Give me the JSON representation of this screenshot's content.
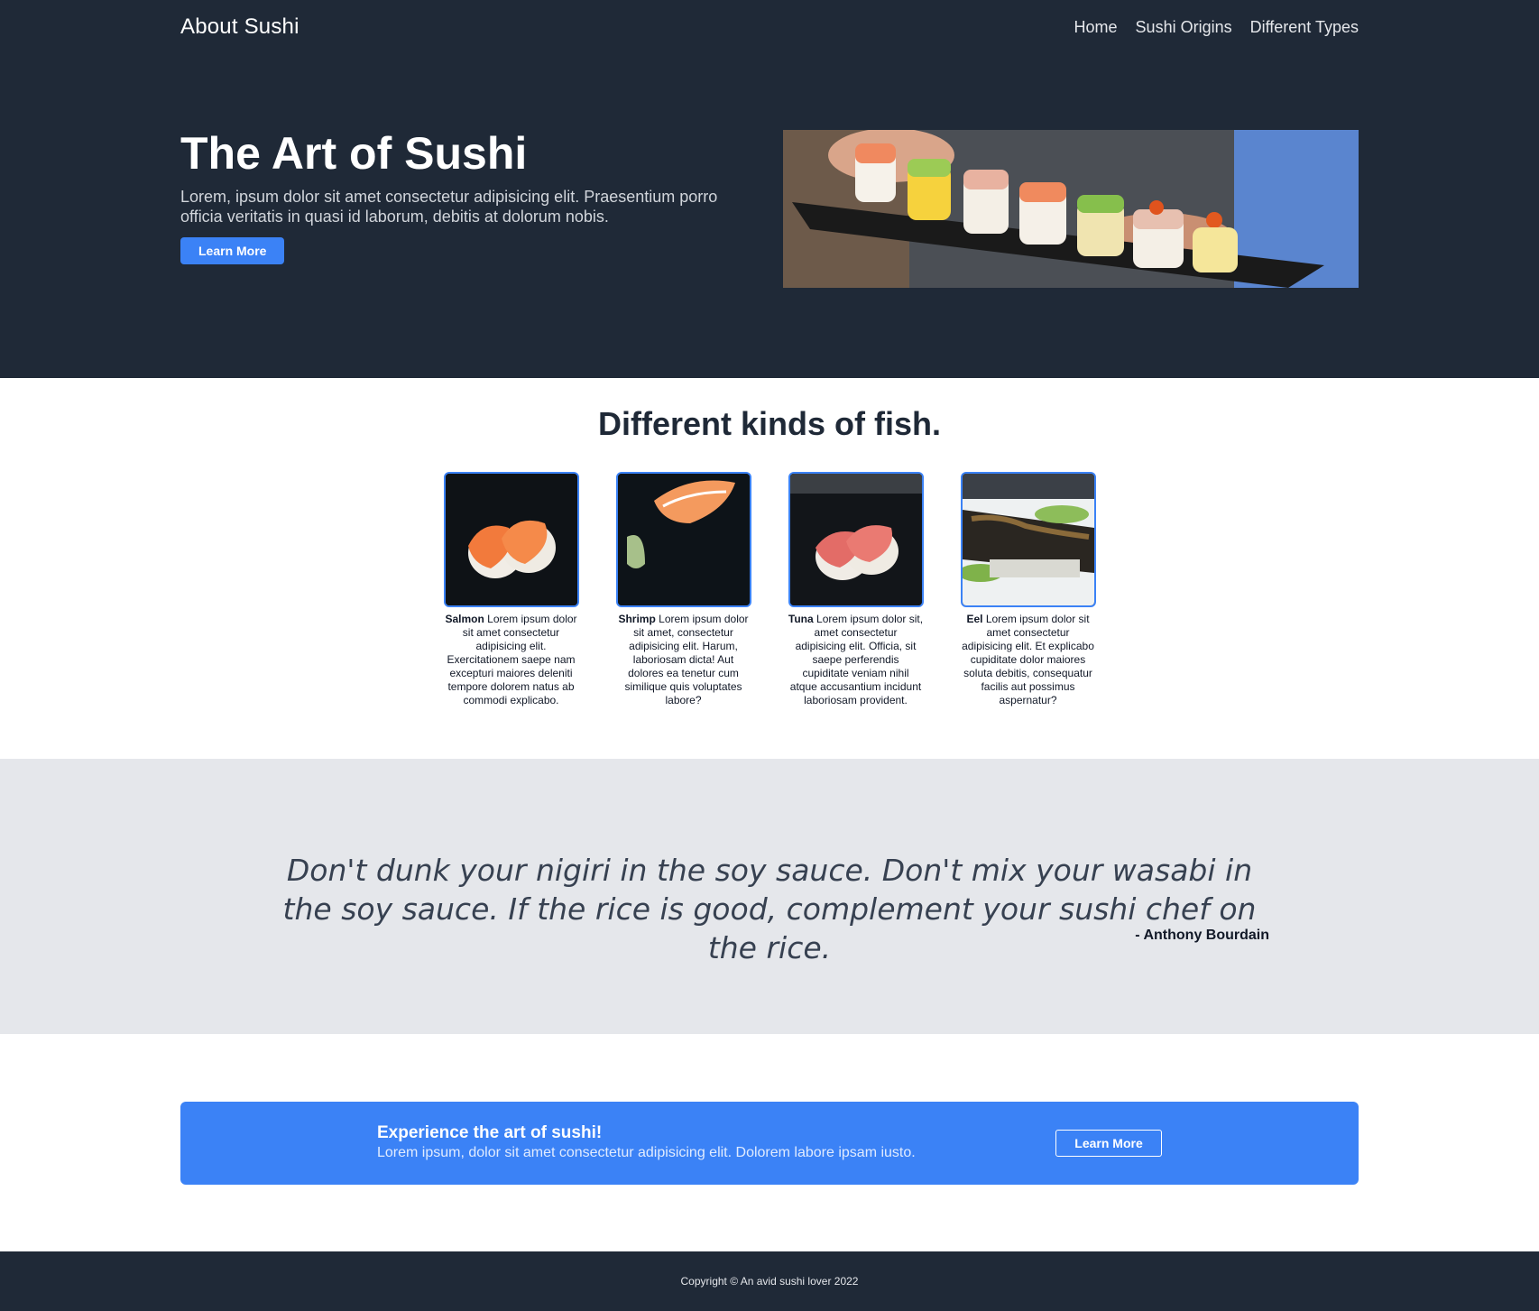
{
  "header": {
    "brand": "About Sushi",
    "nav": [
      "Home",
      "Sushi Origins",
      "Different Types"
    ]
  },
  "hero": {
    "title": "The Art of Sushi",
    "subtitle": "Lorem, ipsum dolor sit amet consectetur adipisicing elit. Praesentium porro officia veritatis in quasi id laborum, debitis at dolorum nobis.",
    "button": "Learn More"
  },
  "fish": {
    "title": "Different kinds of fish.",
    "items": [
      {
        "name": "Salmon",
        "text": "Lorem ipsum dolor sit amet consectetur adipisicing elit. Exercitationem saepe nam excepturi maiores deleniti tempore dolorem natus ab commodi explicabo."
      },
      {
        "name": "Shrimp",
        "text": "Lorem ipsum dolor sit amet, consectetur adipisicing elit. Harum, laboriosam dicta! Aut dolores ea tenetur cum similique quis voluptates labore?"
      },
      {
        "name": "Tuna",
        "text": "Lorem ipsum dolor sit, amet consectetur adipisicing elit. Officia, sit saepe perferendis cupiditate veniam nihil atque accusantium incidunt laboriosam provident."
      },
      {
        "name": "Eel",
        "text": "Lorem ipsum dolor sit amet consectetur adipisicing elit. Et explicabo cupiditate dolor maiores soluta debitis, consequatur facilis aut possimus aspernatur?"
      }
    ]
  },
  "quote": {
    "text": "Don't dunk your nigiri in the soy sauce. Don't mix your wasabi in the soy sauce. If the rice is good, complement your sushi chef on the rice.",
    "author": "- Anthony Bourdain"
  },
  "cta": {
    "title": "Experience the art of sushi!",
    "subtitle": "Lorem ipsum, dolor sit amet consectetur adipisicing elit. Dolorem labore ipsam iusto.",
    "button": "Learn More"
  },
  "footer": {
    "text": "Copyright © An avid sushi lover 2022"
  },
  "colors": {
    "dark": "#1f2937",
    "accent": "#3b82f6",
    "quote_bg": "#e5e7eb"
  }
}
